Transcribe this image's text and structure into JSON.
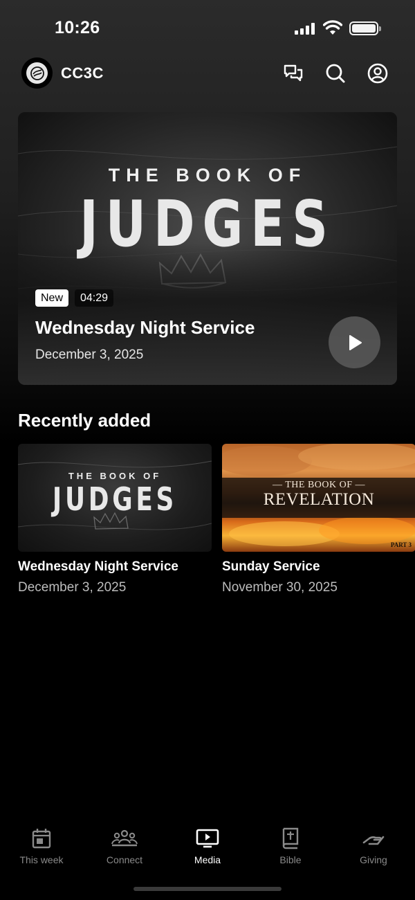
{
  "status_bar": {
    "time": "10:26"
  },
  "header": {
    "app_name": "CC3C"
  },
  "featured": {
    "art_pretitle": "THE BOOK OF",
    "art_title": "JUDGES",
    "badge": "New",
    "duration": "04:29",
    "title": "Wednesday Night Service",
    "date": "December 3, 2025"
  },
  "recently_added": {
    "heading": "Recently added",
    "items": [
      {
        "art_pretitle": "THE BOOK OF",
        "art_title": "JUDGES",
        "title": "Wednesday Night Service",
        "date": "December 3, 2025"
      },
      {
        "art_pretitle": "— THE BOOK OF —",
        "art_title": "REVELATION",
        "art_part": "PART 3",
        "title": "Sunday Service",
        "date": "November 30, 2025"
      }
    ]
  },
  "tabbar": {
    "tabs": [
      {
        "label": "This week",
        "icon": "calendar-icon"
      },
      {
        "label": "Connect",
        "icon": "group-icon"
      },
      {
        "label": "Media",
        "icon": "tv-play-icon",
        "active": true
      },
      {
        "label": "Bible",
        "icon": "bible-icon"
      },
      {
        "label": "Giving",
        "icon": "giving-hand-icon"
      }
    ]
  },
  "colors": {
    "background": "#000000",
    "active_tab": "#ffffff",
    "inactive_tab": "#8a8a8a"
  }
}
